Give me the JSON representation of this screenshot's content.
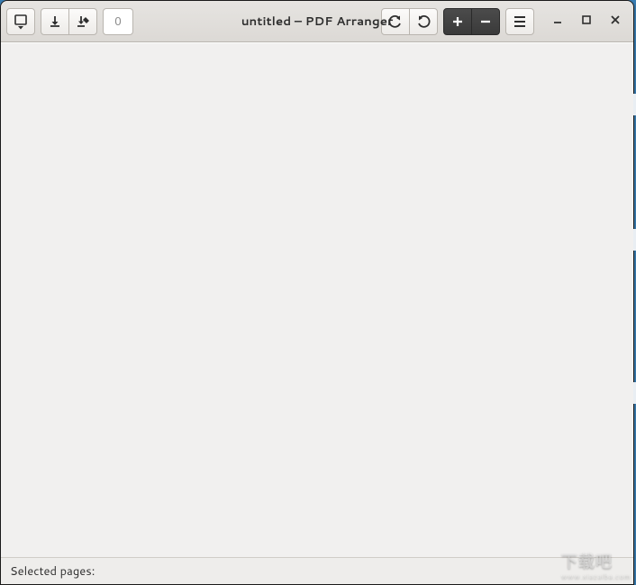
{
  "header": {
    "title": "untitled – PDF Arranger",
    "page_input_value": "0",
    "page_input_placeholder": "0",
    "buttons": {
      "open_menu": "open-document-menu",
      "save": "save-document",
      "save_as": "save-as",
      "rotate_left": "rotate-left",
      "rotate_right": "rotate-right",
      "zoom_in": "zoom-in",
      "zoom_out": "zoom-out",
      "main_menu": "main-menu"
    }
  },
  "status": {
    "selected_label": "Selected pages:",
    "selected_value": ""
  },
  "window_controls": {
    "minimize": "minimize",
    "maximize": "maximize",
    "close": "close"
  },
  "watermark": {
    "text": "下载吧",
    "sub": "www.xiazaiba.com"
  }
}
